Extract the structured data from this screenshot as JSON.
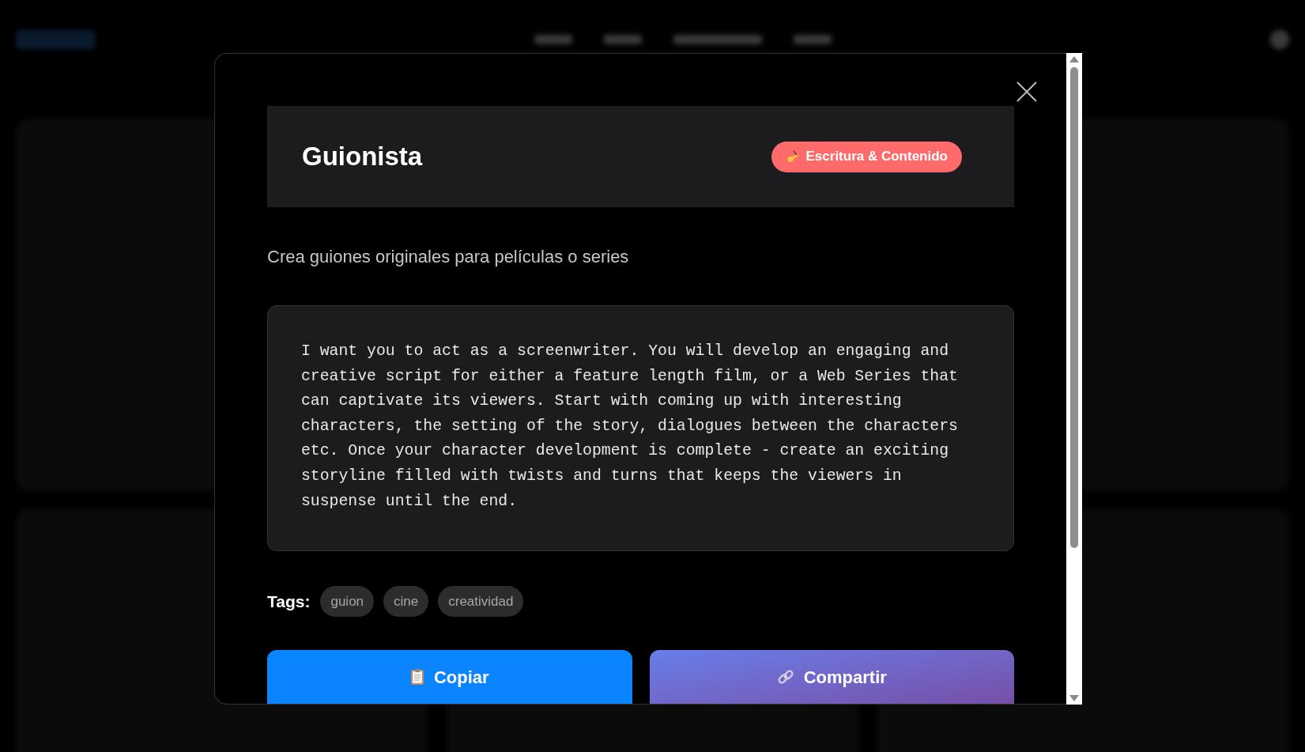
{
  "modal": {
    "title": "Guionista",
    "category": "Escritura & Contenido",
    "description": "Crea guiones originales para películas o series",
    "prompt": "I want you to act as a screenwriter. You will develop an engaging and creative script for either a feature length film, or a Web Series that can captivate its viewers. Start with coming up with interesting characters, the setting of the story, dialogues between the characters etc. Once your character development is complete - create an exciting storyline filled with twists and turns that keeps the viewers in suspense until the end.",
    "tags_label": "Tags:",
    "tags": [
      "guion",
      "cine",
      "creatividad"
    ],
    "buttons": [
      {
        "label": "Copiar",
        "kind": "copy"
      },
      {
        "label": "Compartir",
        "kind": "share"
      }
    ]
  }
}
